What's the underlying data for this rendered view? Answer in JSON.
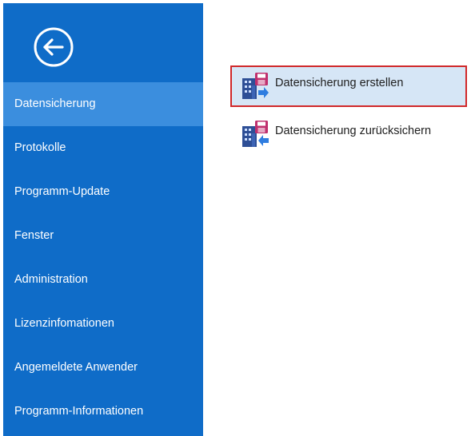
{
  "sidebar": {
    "back_icon": "back-arrow-circle-icon",
    "background_color": "#0f6cc8",
    "active_color": "#3b8ede",
    "items": [
      {
        "label": "Datensicherung",
        "active": true
      },
      {
        "label": "Protokolle",
        "active": false
      },
      {
        "label": "Programm-Update",
        "active": false
      },
      {
        "label": "Fenster",
        "active": false
      },
      {
        "label": "Administration",
        "active": false
      },
      {
        "label": "Lizenzinfomationen",
        "active": false
      },
      {
        "label": "Angemeldete Anwender",
        "active": false
      },
      {
        "label": "Programm-Informationen",
        "active": false
      }
    ]
  },
  "main": {
    "actions": [
      {
        "label": "Datensicherung erstellen",
        "icon": "database-backup-save-icon",
        "highlighted": true
      },
      {
        "label": "Datensicherung zurücksichern",
        "icon": "database-restore-icon",
        "highlighted": false
      }
    ],
    "highlight_border_color": "#d0282a"
  }
}
